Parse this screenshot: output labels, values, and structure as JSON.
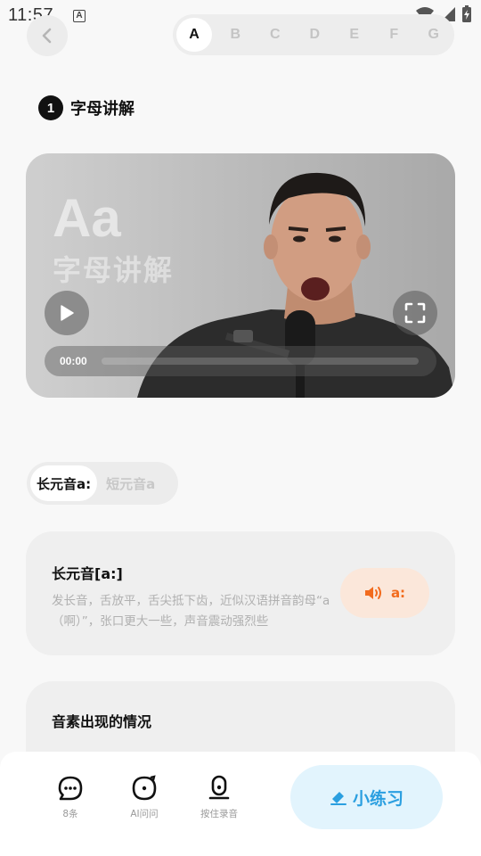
{
  "status_bar": {
    "time": "11:57",
    "notification_icon": "a-icon"
  },
  "nav": {
    "letters": [
      "A",
      "B",
      "C",
      "D",
      "E",
      "F",
      "G"
    ],
    "active_letter": "A"
  },
  "section": {
    "number": "1",
    "title": "字母讲解"
  },
  "video": {
    "overlay_big": "Aa",
    "overlay_sub": "字母讲解",
    "current_time": "00:00",
    "progress": 0
  },
  "vowel_toggle": {
    "long_label": "长元音a:",
    "short_label": "短元音a",
    "active": "long"
  },
  "long_vowel_card": {
    "title": "长元音[a:]",
    "description": "发长音，舌放平，舌尖抵下齿，近似汉语拼音韵母“a（啊）”，张口更大一些，声音震动强烈些",
    "sound_label": "a:"
  },
  "occurrence_card": {
    "title": "音素出现的情况"
  },
  "bottom_bar": {
    "comments_label": "8条",
    "ai_label": "AI问问",
    "record_label": "按住录音",
    "practice_label": "小练习"
  },
  "colors": {
    "accent_orange": "#f26b1d",
    "accent_blue": "#2b9fe0"
  }
}
